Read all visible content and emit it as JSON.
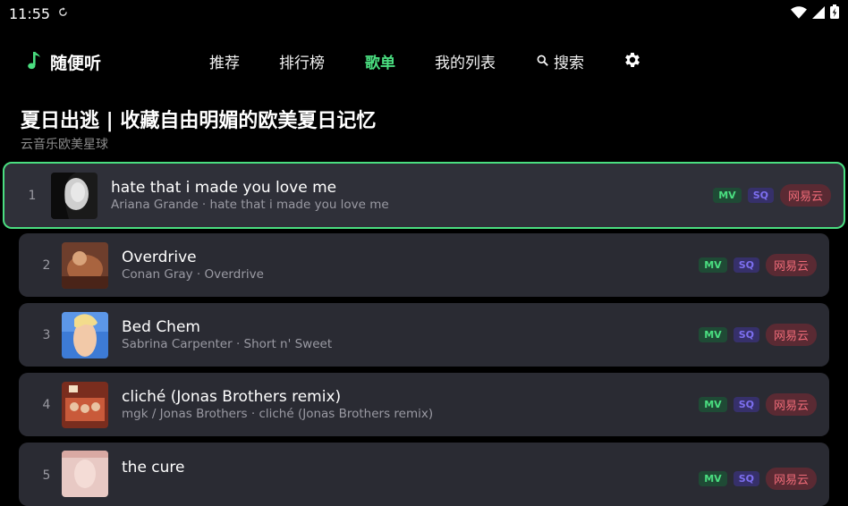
{
  "status": {
    "time": "11:55"
  },
  "app": {
    "name": "随便听"
  },
  "nav": {
    "tabs": [
      {
        "label": "推荐"
      },
      {
        "label": "排行榜"
      },
      {
        "label": "歌单"
      },
      {
        "label": "我的列表"
      },
      {
        "label": "搜索"
      }
    ],
    "active_tab": "歌单"
  },
  "playlist": {
    "title": "夏日出逃 | 收藏自由明媚的欧美夏日记忆",
    "subtitle": "云音乐欧美星球"
  },
  "colors": {
    "accent": "#4ade80",
    "row_bg": "#2a2b33",
    "mv_badge": "#4ade80",
    "sq_badge": "#7d6ff0",
    "source_badge": "#f06b78"
  },
  "songs": [
    {
      "num": "1",
      "title": "hate that i made you love me",
      "subtitle": "Ariana Grande · hate that i made you love me",
      "mv": "MV",
      "sq": "SQ",
      "source": "网易云"
    },
    {
      "num": "2",
      "title": "Overdrive",
      "subtitle": "Conan Gray · Overdrive",
      "mv": "MV",
      "sq": "SQ",
      "source": "网易云"
    },
    {
      "num": "3",
      "title": "Bed Chem",
      "subtitle": "Sabrina Carpenter · Short n' Sweet",
      "mv": "MV",
      "sq": "SQ",
      "source": "网易云"
    },
    {
      "num": "4",
      "title": "cliché (Jonas Brothers remix)",
      "subtitle": "mgk / Jonas Brothers · cliché (Jonas Brothers remix)",
      "mv": "MV",
      "sq": "SQ",
      "source": "网易云"
    },
    {
      "num": "5",
      "title": "the cure",
      "subtitle": "",
      "mv": "MV",
      "sq": "SQ",
      "source": "网易云"
    }
  ]
}
